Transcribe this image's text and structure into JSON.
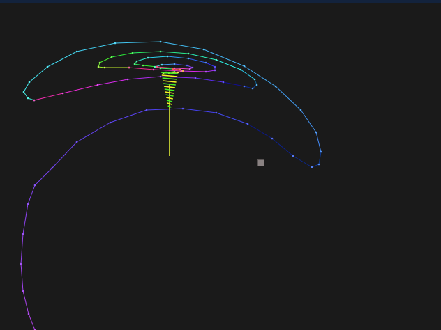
{
  "colors": {
    "background": "#1a1a1a",
    "top_strip": "#13233d",
    "stem": "#b8c230",
    "handle_fill": "#8a8282",
    "node_radius_hint": "small"
  },
  "scene": {
    "description_none": "",
    "curve_color_mode": "rainbow-gradient"
  }
}
